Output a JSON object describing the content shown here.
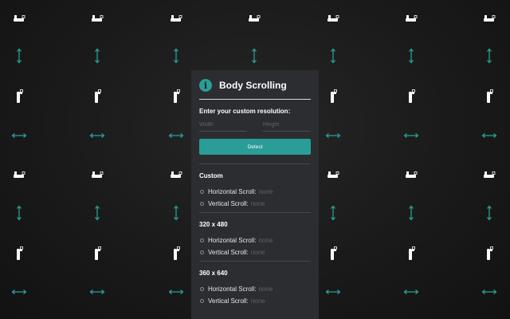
{
  "window": {
    "title": "Body Scrolling",
    "info_icon_glyph": "i",
    "accent_color": "#2a9d96",
    "panel_color": "#2b2d31"
  },
  "form": {
    "prompt": "Enter your custom resolution:",
    "width_placeholder": "Width",
    "height_placeholder": "Height",
    "detect_label": "Detect"
  },
  "sections": [
    {
      "title": "Custom",
      "horizontal_label": "Horizontal Scroll:",
      "horizontal_value": "none",
      "vertical_label": "Vertical Scroll:",
      "vertical_value": "none"
    },
    {
      "title": "320 x 480",
      "horizontal_label": "Horizontal Scroll:",
      "horizontal_value": "none",
      "vertical_label": "Vertical Scroll:",
      "vertical_value": "none"
    },
    {
      "title": "360 x 640",
      "horizontal_label": "Horizontal Scroll:",
      "horizontal_value": "none",
      "vertical_label": "Vertical Scroll:",
      "vertical_value": "none"
    }
  ],
  "background": {
    "icons": [
      "mouse-right-icon",
      "vertical-arrow-icon",
      "mouse-up-icon",
      "horizontal-arrow-icon"
    ],
    "arrow_color": "#2a9d96",
    "mouse_color": "#ffffff"
  }
}
